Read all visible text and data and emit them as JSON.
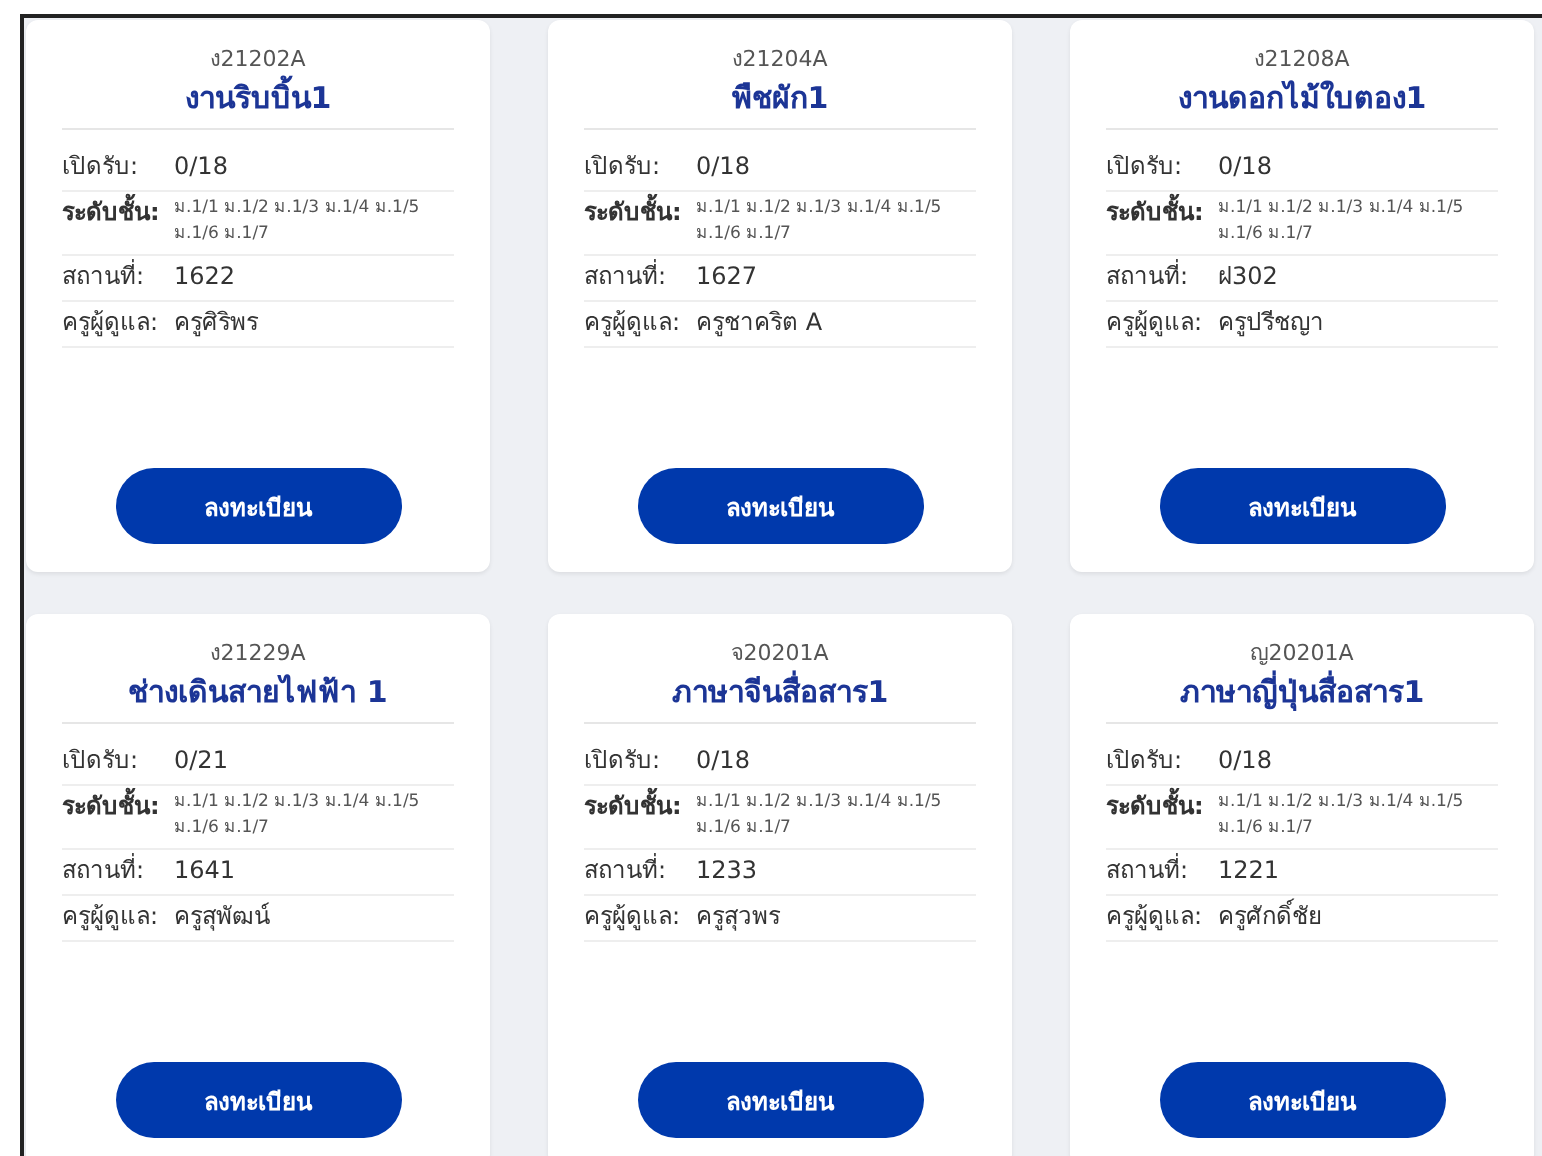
{
  "cards": [
    {
      "code": "ง21202A",
      "title": "งานริบบิ้น1",
      "fields": [
        {
          "kind": "plain",
          "label": "เปิดรับ:",
          "value": "0/18"
        },
        {
          "kind": "small",
          "label": "ระดับชั้น:",
          "value": "ม.1/1 ม.1/2 ม.1/3 ม.1/4 ม.1/5 ม.1/6 ม.1/7"
        },
        {
          "kind": "plain",
          "label": "สถานที่:",
          "value": "1622"
        },
        {
          "kind": "plain",
          "label": "ครูผู้ดูแล:",
          "value": "ครูศิริพร"
        }
      ],
      "button": "ลงทะเบียน"
    },
    {
      "code": "ง21204A",
      "title": "พืชผัก1",
      "fields": [
        {
          "kind": "plain",
          "label": "เปิดรับ:",
          "value": "0/18"
        },
        {
          "kind": "small",
          "label": "ระดับชั้น:",
          "value": "ม.1/1 ม.1/2 ม.1/3 ม.1/4 ม.1/5 ม.1/6 ม.1/7"
        },
        {
          "kind": "plain",
          "label": "สถานที่:",
          "value": "1627"
        },
        {
          "kind": "plain",
          "label": "ครูผู้ดูแล:",
          "value": "ครูชาคริต A"
        }
      ],
      "button": "ลงทะเบียน"
    },
    {
      "code": "ง21208A",
      "title": "งานดอกไม้ใบตอง1",
      "fields": [
        {
          "kind": "plain",
          "label": "เปิดรับ:",
          "value": "0/18"
        },
        {
          "kind": "small",
          "label": "ระดับชั้น:",
          "value": "ม.1/1 ม.1/2 ม.1/3 ม.1/4 ม.1/5 ม.1/6 ม.1/7"
        },
        {
          "kind": "plain",
          "label": "สถานที่:",
          "value": "ฝ302"
        },
        {
          "kind": "plain",
          "label": "ครูผู้ดูแล:",
          "value": "ครูปรีชญา"
        }
      ],
      "button": "ลงทะเบียน"
    },
    {
      "code": "ง21229A",
      "title": "ช่างเดินสายไฟฟ้า 1",
      "fields": [
        {
          "kind": "plain",
          "label": "เปิดรับ:",
          "value": "0/21"
        },
        {
          "kind": "small",
          "label": "ระดับชั้น:",
          "value": "ม.1/1 ม.1/2 ม.1/3 ม.1/4 ม.1/5 ม.1/6 ม.1/7"
        },
        {
          "kind": "plain",
          "label": "สถานที่:",
          "value": "1641"
        },
        {
          "kind": "plain",
          "label": "ครูผู้ดูแล:",
          "value": "ครูสุพัฒน์"
        }
      ],
      "button": "ลงทะเบียน"
    },
    {
      "code": "จ20201A",
      "title": "ภาษาจีนสื่อสาร1",
      "fields": [
        {
          "kind": "plain",
          "label": "เปิดรับ:",
          "value": "0/18"
        },
        {
          "kind": "small",
          "label": "ระดับชั้น:",
          "value": "ม.1/1 ม.1/2 ม.1/3 ม.1/4 ม.1/5 ม.1/6 ม.1/7"
        },
        {
          "kind": "plain",
          "label": "สถานที่:",
          "value": "1233"
        },
        {
          "kind": "plain",
          "label": "ครูผู้ดูแล:",
          "value": "ครูสุวพร"
        }
      ],
      "button": "ลงทะเบียน"
    },
    {
      "code": "ญ20201A",
      "title": "ภาษาญี่ปุ่นสื่อสาร1",
      "fields": [
        {
          "kind": "plain",
          "label": "เปิดรับ:",
          "value": "0/18"
        },
        {
          "kind": "small",
          "label": "ระดับชั้น:",
          "value": "ม.1/1 ม.1/2 ม.1/3 ม.1/4 ม.1/5 ม.1/6 ม.1/7"
        },
        {
          "kind": "plain",
          "label": "สถานที่:",
          "value": "1221"
        },
        {
          "kind": "plain",
          "label": "ครูผู้ดูแล:",
          "value": "ครูศักดิ์ชัย"
        }
      ],
      "button": "ลงทะเบียน"
    }
  ]
}
